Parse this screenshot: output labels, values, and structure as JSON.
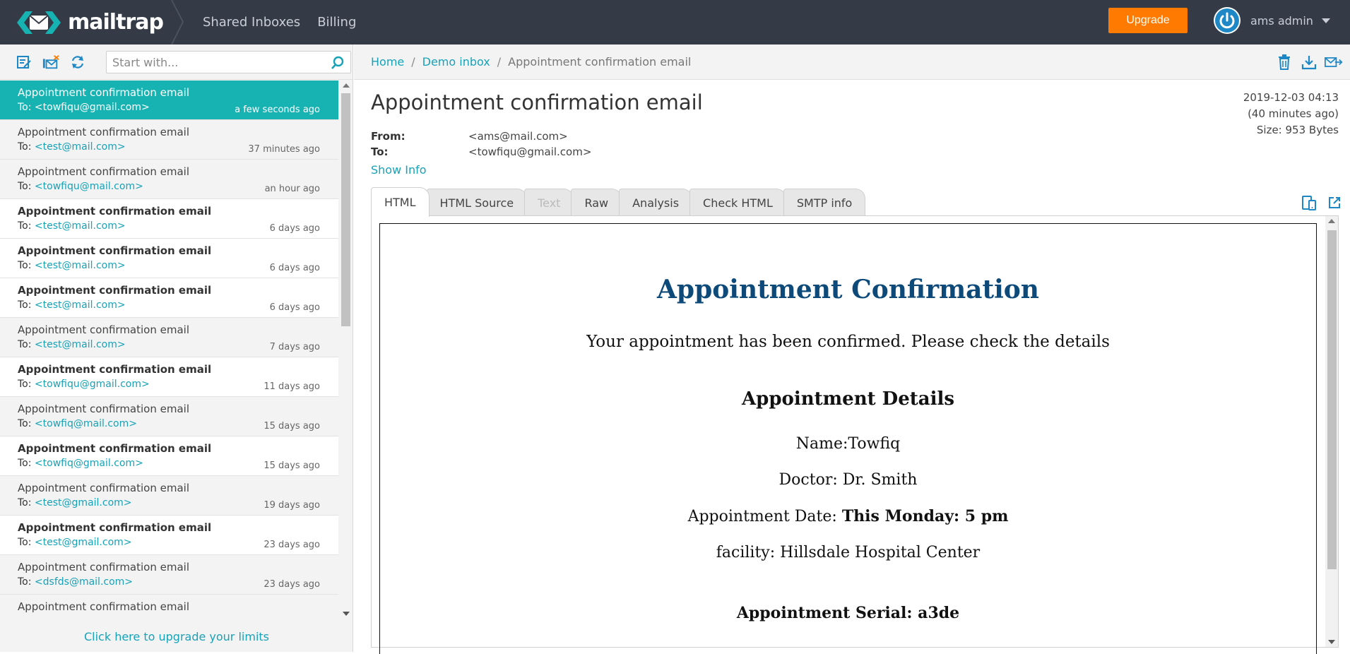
{
  "app": {
    "logo_text": "mailtrap",
    "nav": [
      "Shared Inboxes",
      "Billing"
    ],
    "upgrade_label": "Upgrade",
    "user_name": "ams admin"
  },
  "sidebar": {
    "search_placeholder": "Start with...",
    "upgrade_link": "Click here to upgrade your limits",
    "messages": [
      {
        "subject": "Appointment confirmation email",
        "to_label": "To:",
        "to": "<towfiqu@gmail.com>",
        "time": "a few seconds ago",
        "state": "active"
      },
      {
        "subject": "Appointment confirmation email",
        "to_label": "To:",
        "to": "<test@mail.com>",
        "time": "37 minutes ago",
        "state": "read"
      },
      {
        "subject": "Appointment confirmation email",
        "to_label": "To:",
        "to": "<towfiqu@mail.com>",
        "time": "an hour ago",
        "state": "read"
      },
      {
        "subject": "Appointment confirmation email",
        "to_label": "To:",
        "to": "<test@mail.com>",
        "time": "6 days ago",
        "state": "unread"
      },
      {
        "subject": "Appointment confirmation email",
        "to_label": "To:",
        "to": "<test@mail.com>",
        "time": "6 days ago",
        "state": "unread"
      },
      {
        "subject": "Appointment confirmation email",
        "to_label": "To:",
        "to": "<test@mail.com>",
        "time": "6 days ago",
        "state": "unread"
      },
      {
        "subject": "Appointment confirmation email",
        "to_label": "To:",
        "to": "<test@mail.com>",
        "time": "7 days ago",
        "state": "read"
      },
      {
        "subject": "Appointment confirmation email",
        "to_label": "To:",
        "to": "<towfiqu@gmail.com>",
        "time": "11 days ago",
        "state": "unread"
      },
      {
        "subject": "Appointment confirmation email",
        "to_label": "To:",
        "to": "<towfiq@mail.com>",
        "time": "15 days ago",
        "state": "read"
      },
      {
        "subject": "Appointment confirmation email",
        "to_label": "To:",
        "to": "<towfiq@gmail.com>",
        "time": "15 days ago",
        "state": "unread"
      },
      {
        "subject": "Appointment confirmation email",
        "to_label": "To:",
        "to": "<test@gmail.com>",
        "time": "19 days ago",
        "state": "read"
      },
      {
        "subject": "Appointment confirmation email",
        "to_label": "To:",
        "to": "<test@gmail.com>",
        "time": "23 days ago",
        "state": "unread"
      },
      {
        "subject": "Appointment confirmation email",
        "to_label": "To:",
        "to": "<dsfds@mail.com>",
        "time": "23 days ago",
        "state": "read"
      },
      {
        "subject": "Appointment confirmation email",
        "to_label": "",
        "to": "",
        "time": "",
        "state": "read"
      }
    ]
  },
  "breadcrumb": {
    "home": "Home",
    "inbox": "Demo inbox",
    "current": "Appointment confirmation email",
    "sep": "/"
  },
  "email": {
    "title": "Appointment confirmation email",
    "date": "2019-12-03 04:13",
    "ago": "(40 minutes ago)",
    "size": "Size: 953 Bytes",
    "from_label": "From:",
    "from": "<ams@mail.com>",
    "to_label": "To:",
    "to": "<towfiqu@gmail.com>",
    "show_info": "Show Info"
  },
  "tabs": [
    {
      "label": "HTML",
      "state": "active"
    },
    {
      "label": "HTML Source",
      "state": "normal"
    },
    {
      "label": "Text",
      "state": "disabled"
    },
    {
      "label": "Raw",
      "state": "normal"
    },
    {
      "label": "Analysis",
      "state": "normal"
    },
    {
      "label": "Check HTML",
      "state": "normal"
    },
    {
      "label": "SMTP info",
      "state": "normal"
    }
  ],
  "preview": {
    "title": "Appointment Confirmation",
    "intro": "Your appointment has been confirmed. Please check the details",
    "subtitle": "Appointment Details",
    "name": "Name:Towfiq",
    "doctor": "Doctor: Dr. Smith",
    "date_label": "Appointment Date: ",
    "date_value": "This Monday: 5 pm",
    "facility": "facility: Hillsdale Hospital Center",
    "serial": "Appointment Serial: a3de"
  },
  "colors": {
    "topbar": "#343b47",
    "accent": "#17b3b3",
    "link": "#17a2b8",
    "upgrade": "#ff7a00",
    "preview_title": "#0d4a7a"
  },
  "icons": {
    "toolbar": [
      "edit-inbox-icon",
      "clear-inbox-icon",
      "refresh-icon"
    ],
    "actions": [
      "delete-icon",
      "download-icon",
      "forward-icon"
    ],
    "tab_tools": [
      "mobile-view-icon",
      "open-new-window-icon"
    ]
  }
}
